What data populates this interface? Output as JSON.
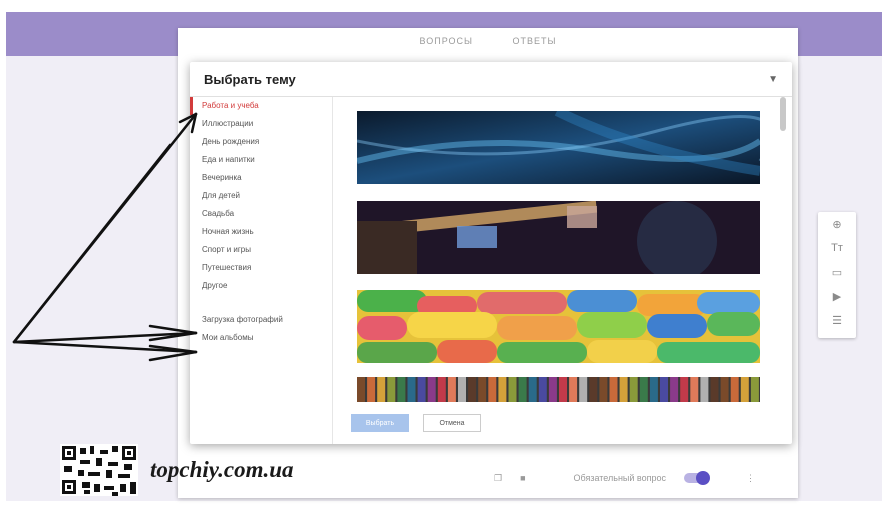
{
  "form_tabs": [
    "ВОПРОСЫ",
    "ОТВЕТЫ"
  ],
  "dialog": {
    "title": "Выбрать тему",
    "categories": [
      {
        "label": "Работа и учеба",
        "active": true
      },
      {
        "label": "Иллюстрации"
      },
      {
        "label": "День рождения"
      },
      {
        "label": "Еда и напитки"
      },
      {
        "label": "Вечеринка"
      },
      {
        "label": "Для детей"
      },
      {
        "label": "Свадьба"
      },
      {
        "label": "Ночная жизнь"
      },
      {
        "label": "Спорт и игры"
      },
      {
        "label": "Путешествия"
      },
      {
        "label": "Другое"
      }
    ],
    "upload_label": "Загрузка фотографий",
    "albums_label": "Мои альбомы",
    "select_button": "Выбрать",
    "cancel_button": "Отмена",
    "active_color": "#d23b3b"
  },
  "themes": [
    "blue-particles-image",
    "guitar-image",
    "colored-pills-image",
    "colored-pencils-image"
  ],
  "card_footer": {
    "required_label": "Обязательный вопрос"
  },
  "side_tools": [
    "add-icon",
    "text-icon",
    "image-icon",
    "video-icon",
    "section-icon"
  ],
  "watermark": {
    "text": "topchiy.com.ua"
  },
  "colors": {
    "band": "#9b8cc9",
    "accent": "#5b4fc4"
  }
}
